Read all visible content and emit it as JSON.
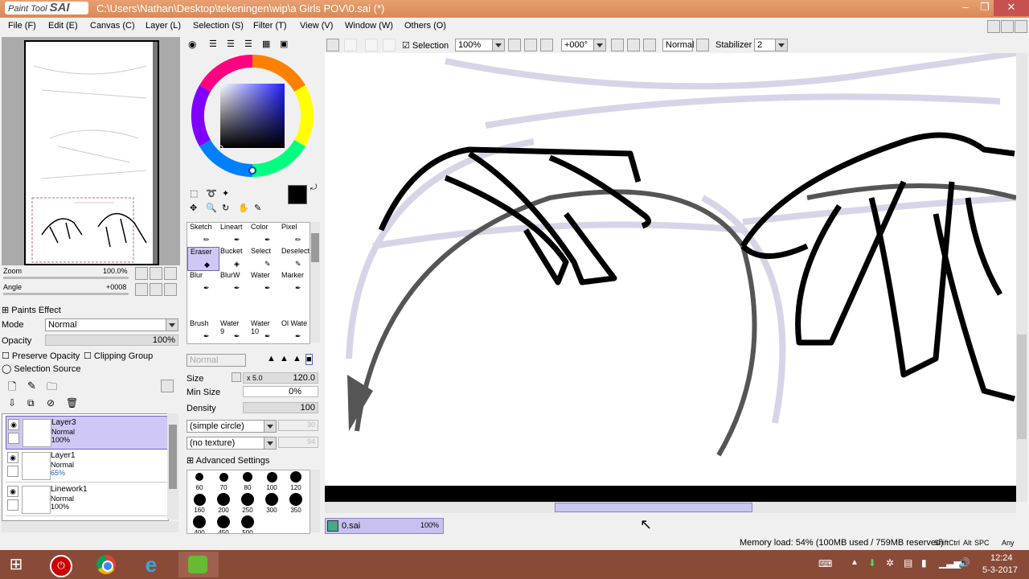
{
  "app": {
    "logo_small": "Paint Tool",
    "logo_big": "SAI",
    "title": "C:\\Users\\Nathan\\Desktop\\tekeningen\\wip\\a Girls POV\\0.sai (*)"
  },
  "window_controls": {
    "minimize": "–",
    "maximize": "❐",
    "close": "✕"
  },
  "menu": [
    "File (F)",
    "Edit (E)",
    "Canvas (C)",
    "Layer (L)",
    "Selection (S)",
    "Filter (T)",
    "View (V)",
    "Window (W)",
    "Others (O)"
  ],
  "navigator": {
    "zoom_label": "Zoom",
    "zoom_value": "100.0%",
    "angle_label": "Angle",
    "angle_value": "+0008"
  },
  "paints_effect": {
    "header": "Paints Effect",
    "mode_label": "Mode",
    "mode_value": "Normal",
    "opacity_label": "Opacity",
    "opacity_value": "100%",
    "preserve_opacity": "Preserve Opacity",
    "clipping_group": "Clipping Group",
    "selection_source": "Selection Source"
  },
  "layers": [
    {
      "name": "Layer3",
      "mode": "Normal",
      "opacity": "100%",
      "selected": true
    },
    {
      "name": "Layer1",
      "mode": "Normal",
      "opacity": "65%",
      "selected": false
    },
    {
      "name": "Linework1",
      "mode": "Normal",
      "opacity": "100%",
      "selected": false
    }
  ],
  "tools": [
    {
      "label": "Sketch"
    },
    {
      "label": "Lineart"
    },
    {
      "label": "Color"
    },
    {
      "label": "Pixel"
    },
    {
      "label": "Eraser"
    },
    {
      "label": "Bucket"
    },
    {
      "label": "Select"
    },
    {
      "label": "Deselect"
    },
    {
      "label": "Blur"
    },
    {
      "label": "BlurW"
    },
    {
      "label": "Water"
    },
    {
      "label": "Marker"
    },
    {
      "label": "",
      "sub": ""
    },
    {
      "label": "",
      "sub": ""
    },
    {
      "label": "",
      "sub": ""
    },
    {
      "label": "",
      "sub": ""
    },
    {
      "label": "Brush",
      "sub": ""
    },
    {
      "label": "Water",
      "sub": "9"
    },
    {
      "label": "Water",
      "sub": "10"
    },
    {
      "label": "Ol Wate",
      "sub": ""
    }
  ],
  "brush_settings": {
    "blend_mode": "Normal",
    "size_label": "Size",
    "size_mult": "x 5.0",
    "size_value": "120.0",
    "min_size_label": "Min Size",
    "min_size_value": "0%",
    "density_label": "Density",
    "density_value": "100",
    "shape": "(simple circle)",
    "shape_num": "30",
    "texture": "(no texture)",
    "texture_num": "94",
    "advanced": "Advanced Settings"
  },
  "brush_sizes": [
    {
      "label": "60",
      "size": 10
    },
    {
      "label": "70",
      "size": 11
    },
    {
      "label": "80",
      "size": 12
    },
    {
      "label": "100",
      "size": 13
    },
    {
      "label": "120",
      "size": 14
    },
    {
      "label": "160",
      "size": 15
    },
    {
      "label": "200",
      "size": 16
    },
    {
      "label": "250",
      "size": 16
    },
    {
      "label": "300",
      "size": 16
    },
    {
      "label": "350",
      "size": 16
    },
    {
      "label": "400",
      "size": 16
    },
    {
      "label": "450",
      "size": 16
    },
    {
      "label": "500",
      "size": 16
    }
  ],
  "canvas_toolbar": {
    "selection_label": "Selection",
    "zoom": "100%",
    "angle": "+000°",
    "blend": "Normal",
    "stabilizer_label": "Stabilizer",
    "stabilizer_value": "2"
  },
  "document_tab": {
    "name": "0.sai",
    "zoom": "100%"
  },
  "status": {
    "memory": "Memory load: 54% (100MB used / 759MB reserved)",
    "keys": [
      "Shift",
      "Ctrl",
      "Alt",
      "SPC",
      "Any"
    ]
  },
  "taskbar": {
    "time": "12:24",
    "date": "5-3-2017"
  },
  "colors": {
    "title_bar": "#d88a58",
    "selected_layer": "#cfc8f5",
    "taskbar": "#8a4a38",
    "primary_color": "#000000"
  }
}
